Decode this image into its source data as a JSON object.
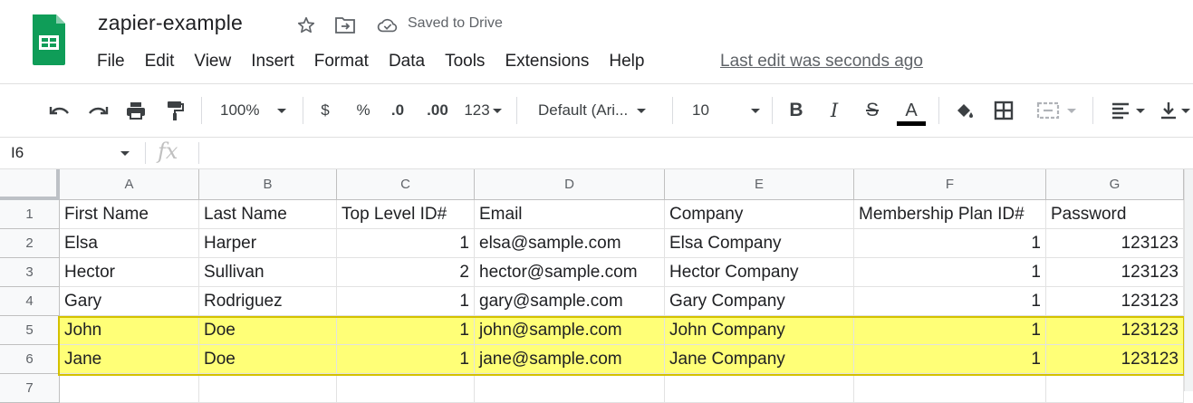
{
  "app": {
    "doc_title": "zapier-example",
    "saved_status": "Saved to Drive",
    "last_edit": "Last edit was seconds ago"
  },
  "menu": [
    "File",
    "Edit",
    "View",
    "Insert",
    "Format",
    "Data",
    "Tools",
    "Extensions",
    "Help"
  ],
  "toolbar": {
    "zoom": "100%",
    "currency": "$",
    "percent": "%",
    "decrease_decimal": ".0",
    "increase_decimal": ".00",
    "more_formats": "123",
    "font": "Default (Ari...",
    "font_size": "10",
    "bold": "B",
    "italic": "I",
    "strike": "S",
    "text_color": "A",
    "colors": {
      "text_color_bar": "#000000",
      "highlight": "#ffff77",
      "logo_green": "#0f9d58"
    }
  },
  "formula_bar": {
    "name_box": "I6",
    "fx": "fx"
  },
  "grid": {
    "columns": [
      "A",
      "B",
      "C",
      "D",
      "E",
      "F",
      "G"
    ],
    "row_numbers": [
      "1",
      "2",
      "3",
      "4",
      "5",
      "6",
      "7"
    ],
    "rows": [
      [
        "First Name",
        "Last Name",
        "Top Level ID#",
        "Email",
        "Company",
        "Membership Plan ID#",
        "Password"
      ],
      [
        "Elsa",
        "Harper",
        "1",
        "elsa@sample.com",
        "Elsa Company",
        "1",
        "123123"
      ],
      [
        "Hector",
        "Sullivan",
        "2",
        "hector@sample.com",
        "Hector Company",
        "1",
        "123123"
      ],
      [
        "Gary",
        "Rodriguez",
        "1",
        "gary@sample.com",
        "Gary Company",
        "1",
        "123123"
      ],
      [
        "John",
        "Doe",
        "1",
        "john@sample.com",
        "John Company",
        "1",
        "123123"
      ],
      [
        "Jane",
        "Doe",
        "1",
        "jane@sample.com",
        "Jane Company",
        "1",
        "123123"
      ],
      [
        "",
        "",
        "",
        "",
        "",
        "",
        ""
      ]
    ],
    "highlighted_rows": [
      5,
      6
    ]
  }
}
